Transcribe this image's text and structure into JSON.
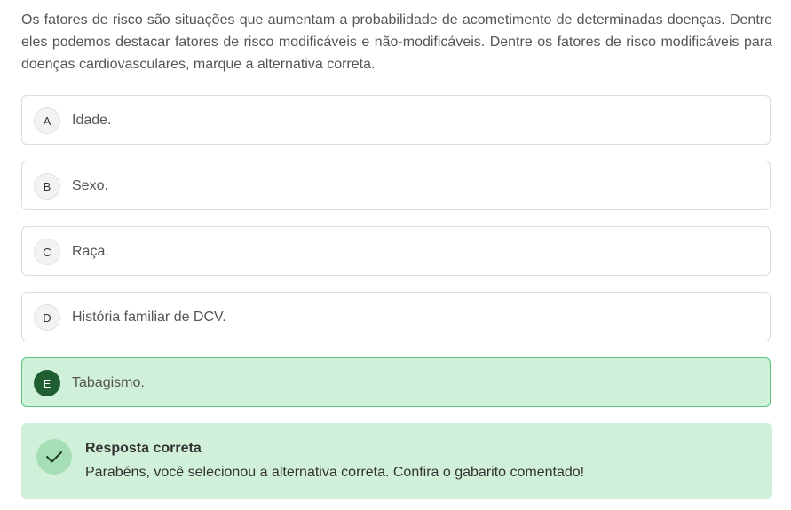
{
  "question": {
    "text": "Os fatores de risco são situações que aumentam a probabilidade de acometimento de determinadas doenças. Dentre eles podemos destacar fatores de risco modificáveis e não-modificáveis. Dentre os fatores de risco modificáveis para doenças cardiovasculares, marque a alternativa correta."
  },
  "options": [
    {
      "letter": "A",
      "text": "Idade."
    },
    {
      "letter": "B",
      "text": "Sexo."
    },
    {
      "letter": "C",
      "text": "Raça."
    },
    {
      "letter": "D",
      "text": "História familiar de DCV."
    },
    {
      "letter": "E",
      "text": "Tabagismo."
    }
  ],
  "selected_option": "E",
  "feedback": {
    "title": "Resposta correta",
    "message": "Parabéns, você selecionou a alternativa correta. Confira o gabarito comentado!",
    "icon": "check-icon"
  },
  "colors": {
    "correct_bg": "#d1f0d9",
    "correct_border": "#5cc47a",
    "correct_badge": "#1e5e32",
    "check_circle": "#a6dfb5"
  }
}
